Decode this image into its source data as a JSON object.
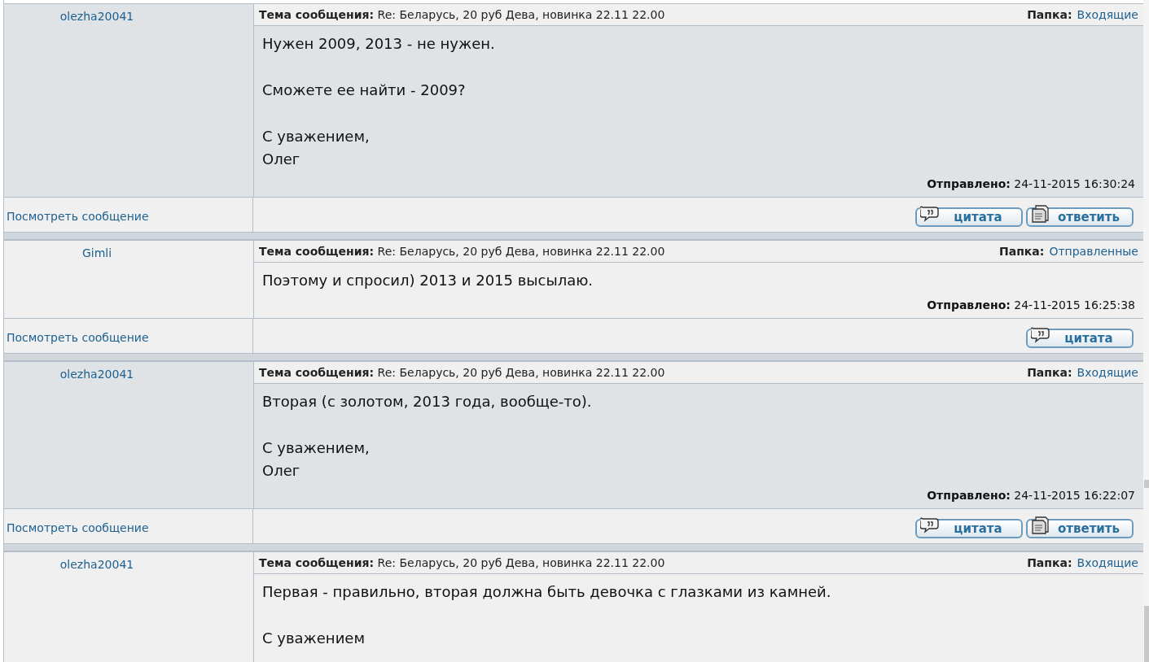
{
  "messages": [
    {
      "author": "olezha20041",
      "shaded": true,
      "subject_label": "Тема сообщения:",
      "subject": "Re: Беларусь, 20 руб Дева, новинка 22.11 22.00",
      "folder_label": "Папка:",
      "folder": "Входящие",
      "paragraphs": [
        [
          "Нужен 2009, 2013 - не нужен."
        ],
        [
          "Сможете ее найти - 2009?"
        ],
        [
          "С уважением,",
          "Олег"
        ]
      ],
      "sent_label": "Отправлено:",
      "sent": "24-11-2015 16:30:24",
      "view_link": "Посмотреть сообщение",
      "buttons": [
        {
          "kind": "quote",
          "label": "цитата"
        },
        {
          "kind": "reply",
          "label": "ответить"
        }
      ]
    },
    {
      "author": "Gimli",
      "shaded": false,
      "subject_label": "Тема сообщения:",
      "subject": "Re: Беларусь, 20 руб Дева, новинка 22.11 22.00",
      "folder_label": "Папка:",
      "folder": "Отправленные",
      "paragraphs": [
        [
          "Поэтому и спросил) 2013 и 2015 высылаю."
        ]
      ],
      "sent_label": "Отправлено:",
      "sent": "24-11-2015 16:25:38",
      "view_link": "Посмотреть сообщение",
      "buttons": [
        {
          "kind": "quote",
          "label": "цитата"
        }
      ]
    },
    {
      "author": "olezha20041",
      "shaded": true,
      "subject_label": "Тема сообщения:",
      "subject": "Re: Беларусь, 20 руб Дева, новинка 22.11 22.00",
      "folder_label": "Папка:",
      "folder": "Входящие",
      "paragraphs": [
        [
          "Вторая (с золотом, 2013 года, вообще-то)."
        ],
        [
          "С уважением,",
          "Олег"
        ]
      ],
      "sent_label": "Отправлено:",
      "sent": "24-11-2015 16:22:07",
      "view_link": "Посмотреть сообщение",
      "buttons": [
        {
          "kind": "quote",
          "label": "цитата"
        },
        {
          "kind": "reply",
          "label": "ответить"
        }
      ]
    },
    {
      "author": "olezha20041",
      "shaded": false,
      "subject_label": "Тема сообщения:",
      "subject": "Re: Беларусь, 20 руб Дева, новинка 22.11 22.00",
      "folder_label": "Папка:",
      "folder": "Входящие",
      "paragraphs": [
        [
          "Первая - правильно, вторая должна быть девочка с глазками из камней."
        ],
        [
          "С уважением"
        ]
      ]
    }
  ]
}
